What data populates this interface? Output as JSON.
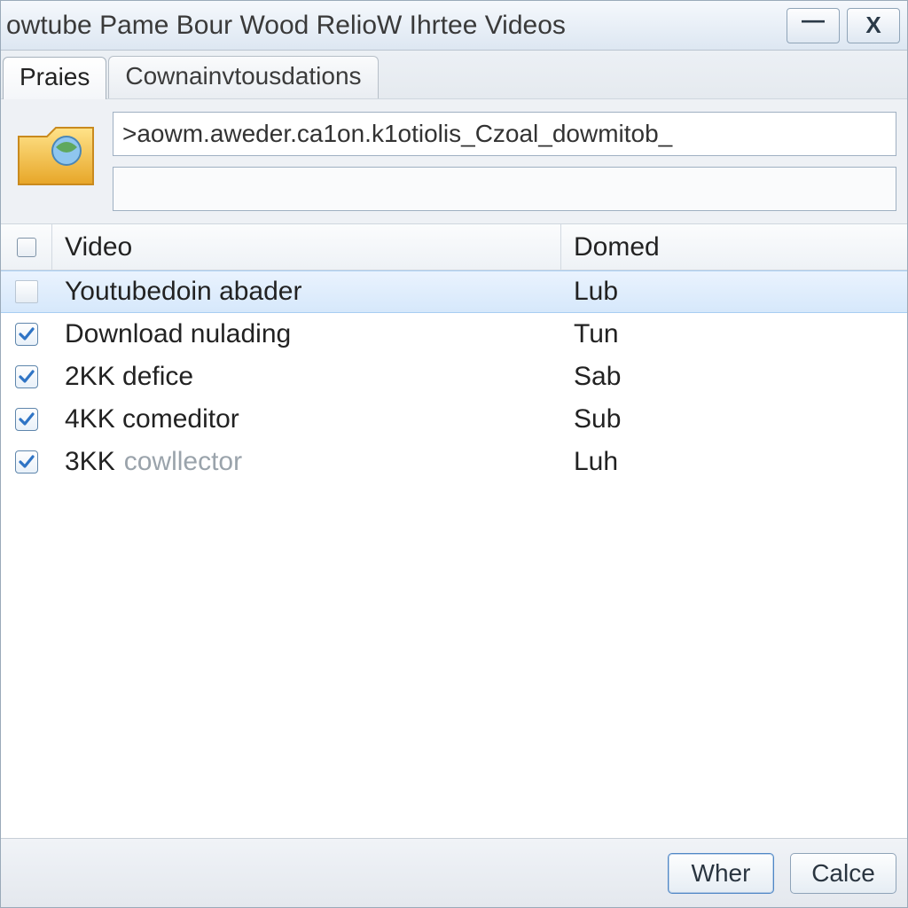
{
  "window": {
    "title": "owtube Pame Bour Wood RelioW Ihrtee Videos"
  },
  "tabs": [
    {
      "label": "Praies",
      "active": true
    },
    {
      "label": "Cownainvtousdations",
      "active": false
    }
  ],
  "url_input": {
    "value": ">aowm.aweder.ca1on.k1otiolis_Czoal_dowmitob_"
  },
  "table": {
    "columns": {
      "video": "Video",
      "domed": "Domed"
    },
    "rows": [
      {
        "checked": false,
        "selected": true,
        "icon": "page",
        "video": "Youtubedoin abader",
        "domed": "Lub"
      },
      {
        "checked": true,
        "selected": false,
        "icon": "check",
        "video": "Download nulading",
        "domed": "Tun"
      },
      {
        "checked": true,
        "selected": false,
        "icon": "check",
        "video": "2KK defice",
        "domed": "Sab"
      },
      {
        "checked": true,
        "selected": false,
        "icon": "check",
        "video": "4KK comeditor",
        "domed": "Sub"
      },
      {
        "checked": true,
        "selected": false,
        "icon": "check",
        "video": "3KK cowllector",
        "video_muted_part": "cowllector",
        "domed": "Luh"
      }
    ]
  },
  "footer": {
    "primary": "Wher",
    "secondary": "Calce"
  }
}
